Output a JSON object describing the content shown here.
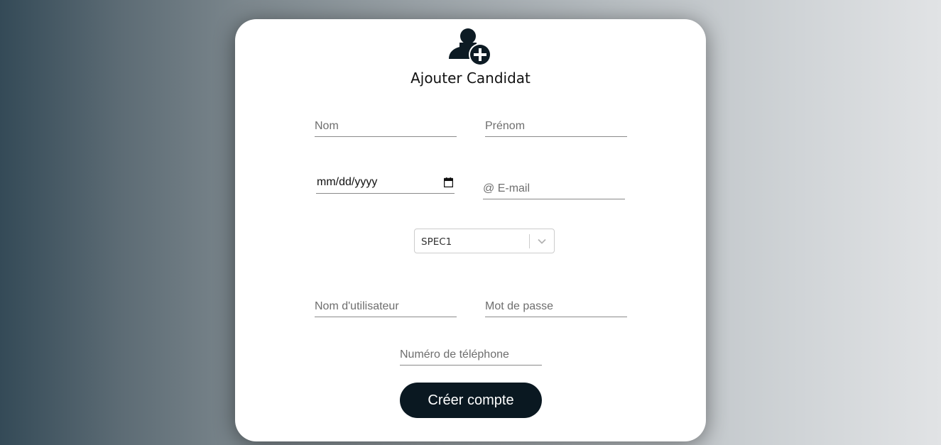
{
  "header": {
    "icon": "user-add-icon",
    "title": "Ajouter Candidat"
  },
  "form": {
    "nom_placeholder": "Nom",
    "prenom_placeholder": "Prénom",
    "date_placeholder": "mm/dd/yyyy",
    "email_placeholder": "@ E-mail",
    "specialite_selected": "SPEC1",
    "username_placeholder": "Nom d'utilisateur",
    "password_placeholder": "Mot de passe",
    "phone_placeholder": "Numéro de téléphone",
    "submit_label": "Créer compte"
  },
  "colors": {
    "button_bg": "#0a1821",
    "icon": "#0d1b24",
    "background_left": "#344a57",
    "background_right": "#e1e3e5"
  }
}
